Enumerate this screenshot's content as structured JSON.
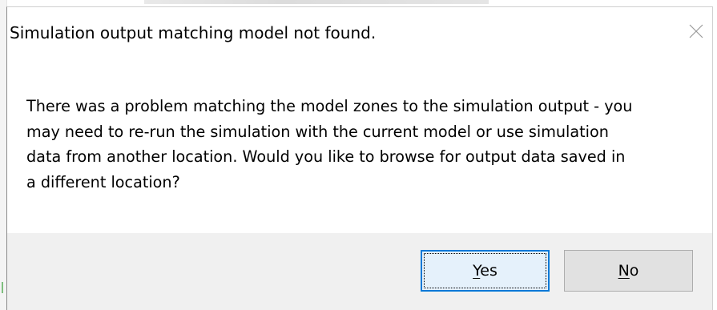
{
  "dialog": {
    "title": "Simulation output matching model not found.",
    "message": "There was a problem matching the model zones to the simulation output - you\nmay need to re-run the simulation with the current model or use simulation\ndata from another location.  Would you like to browse for output data saved in\na different location?",
    "close_icon": "close-icon",
    "buttons": {
      "yes": {
        "mnemonic": "Y",
        "rest": "es"
      },
      "no": {
        "mnemonic": "N",
        "rest": "o"
      }
    }
  },
  "colors": {
    "accent_border": "#0078d7",
    "default_button_bg": "#e5f1fb",
    "button_bg": "#e1e1e1",
    "footer_bg": "#f0f0f0"
  }
}
